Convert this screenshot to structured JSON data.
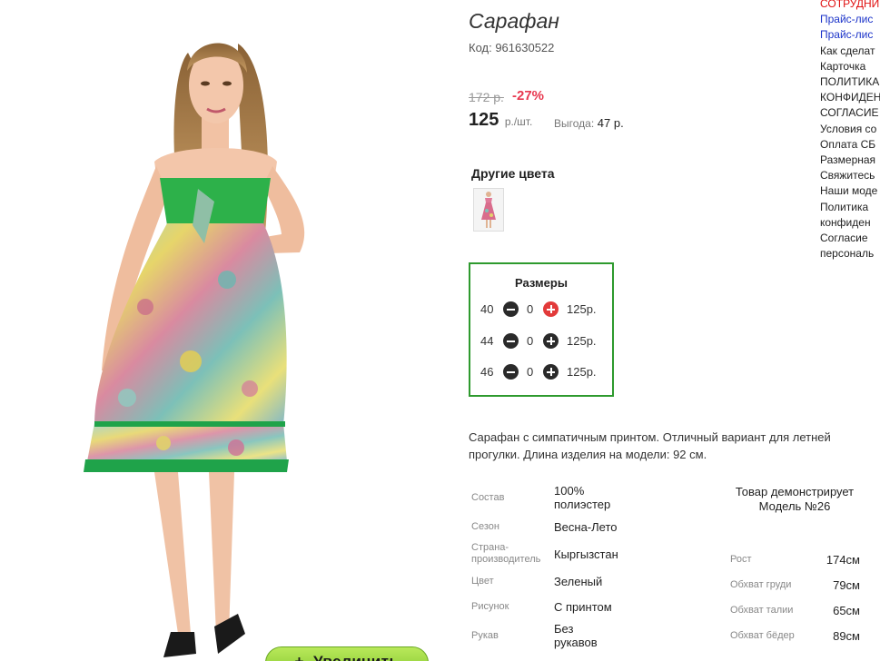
{
  "product": {
    "title": "Сарафан",
    "code": "Код: 961630522",
    "old_price": "172 р.",
    "discount": "-27%",
    "price": "125",
    "price_unit": "р./шт.",
    "benefit_label": "Выгода:",
    "benefit_value": "47 р."
  },
  "zoom_button": {
    "plus": "+",
    "label": "Увеличить"
  },
  "other_colors": {
    "title": "Другие цвета"
  },
  "sizes": {
    "title": "Размеры",
    "rows": [
      {
        "size": "40",
        "qty": "0",
        "price": "125р.",
        "plus_active": true
      },
      {
        "size": "44",
        "qty": "0",
        "price": "125р.",
        "plus_active": false
      },
      {
        "size": "46",
        "qty": "0",
        "price": "125р.",
        "plus_active": false
      }
    ]
  },
  "description": "Сарафан с симпатичным принтом. Отличный вариант для летней прогулки. Длина изделия на модели: 92 см.",
  "properties": [
    {
      "label": "Состав",
      "value": "100% полиэстер"
    },
    {
      "label": "Сезон",
      "value": "Весна-Лето"
    },
    {
      "label": "Страна-производитель",
      "value": "Кыргызстан"
    },
    {
      "label": "Цвет",
      "value": "Зеленый"
    },
    {
      "label": "Рисунок",
      "value": "С принтом"
    },
    {
      "label": "Рукав",
      "value": "Без рукавов"
    }
  ],
  "model": {
    "title": "Товар демонстрирует Модель №26",
    "params": [
      {
        "label": "Рост",
        "value": "174см"
      },
      {
        "label": "Обхват груди",
        "value": "79см"
      },
      {
        "label": "Обхват талии",
        "value": "65см"
      },
      {
        "label": "Обхват бёдер",
        "value": "89см"
      }
    ]
  },
  "side_links": [
    {
      "text": "СОТРУДНИ",
      "color": "red"
    },
    {
      "text": "Прайс-лис",
      "color": "blue"
    },
    {
      "text": "Прайс-лис",
      "color": "blue"
    },
    {
      "text": "Как сделат",
      "color": "dark"
    },
    {
      "text": "Карточка",
      "color": "dark"
    },
    {
      "text": "ПОЛИТИКА",
      "color": "dark"
    },
    {
      "text": "КОНФИДЕН",
      "color": "dark"
    },
    {
      "text": "СОГЛАСИЕ",
      "color": "dark"
    },
    {
      "text": "Условия со",
      "color": "dark"
    },
    {
      "text": "Оплата СБ",
      "color": "dark"
    },
    {
      "text": "Размерная",
      "color": "dark"
    },
    {
      "text": "Свяжитесь",
      "color": "dark"
    },
    {
      "text": "Наши моде",
      "color": "dark"
    },
    {
      "text": "Политика",
      "color": "dark"
    },
    {
      "text": "конфиден",
      "color": "dark"
    },
    {
      "text": "Согласие",
      "color": "dark"
    },
    {
      "text": "персональ",
      "color": "dark"
    }
  ],
  "colors": {
    "accent_green": "#2e9a2e",
    "discount_red": "#e8384f",
    "link_blue": "#1b33c9",
    "link_red": "#e01010"
  }
}
